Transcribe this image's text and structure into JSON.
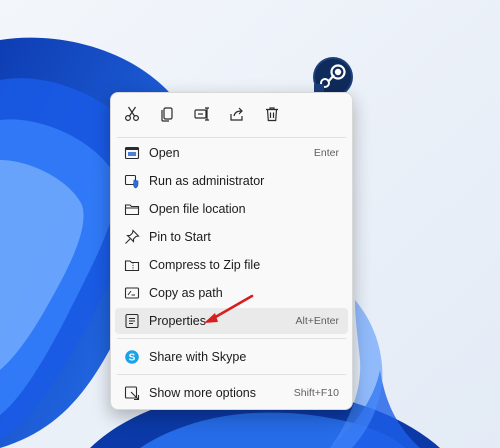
{
  "desktop": {
    "wallpaper": "windows-11-bloom",
    "colors": {
      "background": "#eef3f9",
      "bloom_dark": "#0a3fb8",
      "bloom_mid": "#1e6cf0",
      "bloom_light": "#7fb2ff"
    }
  },
  "steam_shortcut": {
    "icon": "steam-logo"
  },
  "context_menu": {
    "toolbar": [
      {
        "name": "cut",
        "icon": "scissors-icon"
      },
      {
        "name": "copy",
        "icon": "copy-icon"
      },
      {
        "name": "rename",
        "icon": "rename-icon"
      },
      {
        "name": "share",
        "icon": "share-icon"
      },
      {
        "name": "delete",
        "icon": "trash-icon"
      }
    ],
    "items": [
      {
        "label": "Open",
        "shortcut": "Enter",
        "icon": "open-window-icon"
      },
      {
        "label": "Run as administrator",
        "shortcut": "",
        "icon": "admin-shield-icon"
      },
      {
        "label": "Open file location",
        "shortcut": "",
        "icon": "folder-icon"
      },
      {
        "label": "Pin to Start",
        "shortcut": "",
        "icon": "pin-icon"
      },
      {
        "label": "Compress to Zip file",
        "shortcut": "",
        "icon": "zip-folder-icon"
      },
      {
        "label": "Copy as path",
        "shortcut": "",
        "icon": "copy-path-icon"
      },
      {
        "label": "Properties",
        "shortcut": "Alt+Enter",
        "icon": "properties-icon",
        "highlighted": true
      },
      {
        "label": "Share with Skype",
        "shortcut": "",
        "icon": "skype-icon"
      },
      {
        "label": "Show more options",
        "shortcut": "Shift+F10",
        "icon": "more-options-icon"
      }
    ]
  },
  "annotation": {
    "type": "arrow",
    "color": "#d61f1f",
    "points_to": "Properties"
  }
}
